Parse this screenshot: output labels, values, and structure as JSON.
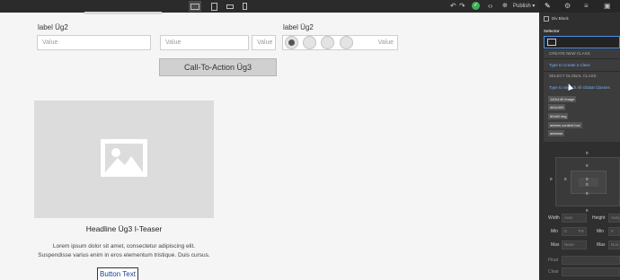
{
  "topbar": {
    "breakpoints": [
      "desktop",
      "tablet",
      "mobile-landscape",
      "mobile-portrait"
    ],
    "undo_icon": "undo-icon",
    "redo_icon": "redo-icon",
    "code_icon": "code-icon",
    "publish_label": "Publish",
    "publish_caret": "▾"
  },
  "form": {
    "label_left": "label Üg2",
    "label_right": "label Üg2",
    "input1_placeholder": "Value",
    "input2_placeholder": "Value",
    "input3_placeholder": "Value",
    "radio_value": "Value"
  },
  "cta_label": "Call-To-Action Üg3",
  "teaser": {
    "headline": "Headline Üg3 I-Teaser",
    "body_line1": "Lorem ipsum dolor sit amet, consectetur adipiscing elit.",
    "body_line2": "Suspendisse varius enim in eros elementum tristique. Duis cursus.",
    "button_text": "Button Text"
  },
  "panel": {
    "element_name": "Div Block",
    "selector_heading": "Selector",
    "create_new_class": "CREATE NEW CLASS",
    "type_to_create": "Type to Create a Class",
    "select_global_class": "SELECT GLOBAL CLASS",
    "type_to_search": "Type to Search All Global Classes",
    "classes": [
      "140x140 image",
      "460x300",
      "60x60 img",
      "adress content box",
      "adresse"
    ],
    "box_values": [
      "0",
      "0",
      "0",
      "0",
      "0",
      "0",
      "0",
      "0"
    ],
    "width_label": "Width",
    "width_value": "Auto",
    "height_label": "Height",
    "height_value": "Auto",
    "min_label": "Min",
    "min_value": "0",
    "min_unit": "PX",
    "min2_label": "Min",
    "min2_value": "0",
    "max_label": "Max",
    "max_value": "None",
    "max2_label": "Max",
    "max2_value": "Non",
    "float_label": "Float",
    "clear_label": "Clear"
  }
}
